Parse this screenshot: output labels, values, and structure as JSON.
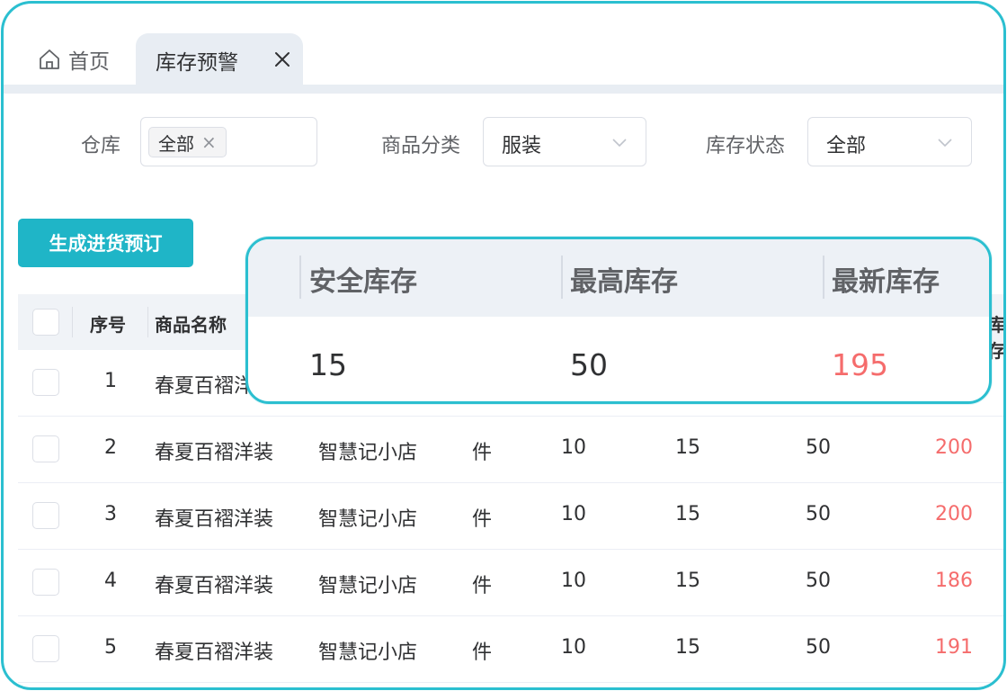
{
  "tabs": {
    "home_label": "首页",
    "active_label": "库存预警"
  },
  "filters": {
    "warehouse": {
      "label": "仓库",
      "chip": "全部"
    },
    "category": {
      "label": "商品分类",
      "value": "服装"
    },
    "stock_status": {
      "label": "库存状态",
      "value": "全部"
    }
  },
  "actions": {
    "generate_order": "生成进货预订"
  },
  "table": {
    "headers": {
      "index": "序号",
      "name": "商品名称",
      "clipped": "库存"
    },
    "rows": [
      {
        "index": "1",
        "name": "春夏百褶洋装",
        "shop": "",
        "unit": "",
        "min": "",
        "safe": "",
        "max": "",
        "latest": ""
      },
      {
        "index": "2",
        "name": "春夏百褶洋装",
        "shop": "智慧记小店",
        "unit": "件",
        "min": "10",
        "safe": "15",
        "max": "50",
        "latest": "200"
      },
      {
        "index": "3",
        "name": "春夏百褶洋装",
        "shop": "智慧记小店",
        "unit": "件",
        "min": "10",
        "safe": "15",
        "max": "50",
        "latest": "200"
      },
      {
        "index": "4",
        "name": "春夏百褶洋装",
        "shop": "智慧记小店",
        "unit": "件",
        "min": "10",
        "safe": "15",
        "max": "50",
        "latest": "186"
      },
      {
        "index": "5",
        "name": "春夏百褶洋装",
        "shop": "智慧记小店",
        "unit": "件",
        "min": "10",
        "safe": "15",
        "max": "50",
        "latest": "191"
      }
    ]
  },
  "callout": {
    "headers": {
      "safe": "安全库存",
      "max": "最高库存",
      "latest": "最新库存"
    },
    "values": {
      "safe": "15",
      "max": "50",
      "latest": "195"
    }
  },
  "colors": {
    "accent": "#1fb5c7",
    "frame": "#2bbfd0",
    "warning": "#f56c6c"
  },
  "icons": {
    "home": "home-icon",
    "close": "close-icon",
    "chevron": "chevron-down-icon"
  }
}
